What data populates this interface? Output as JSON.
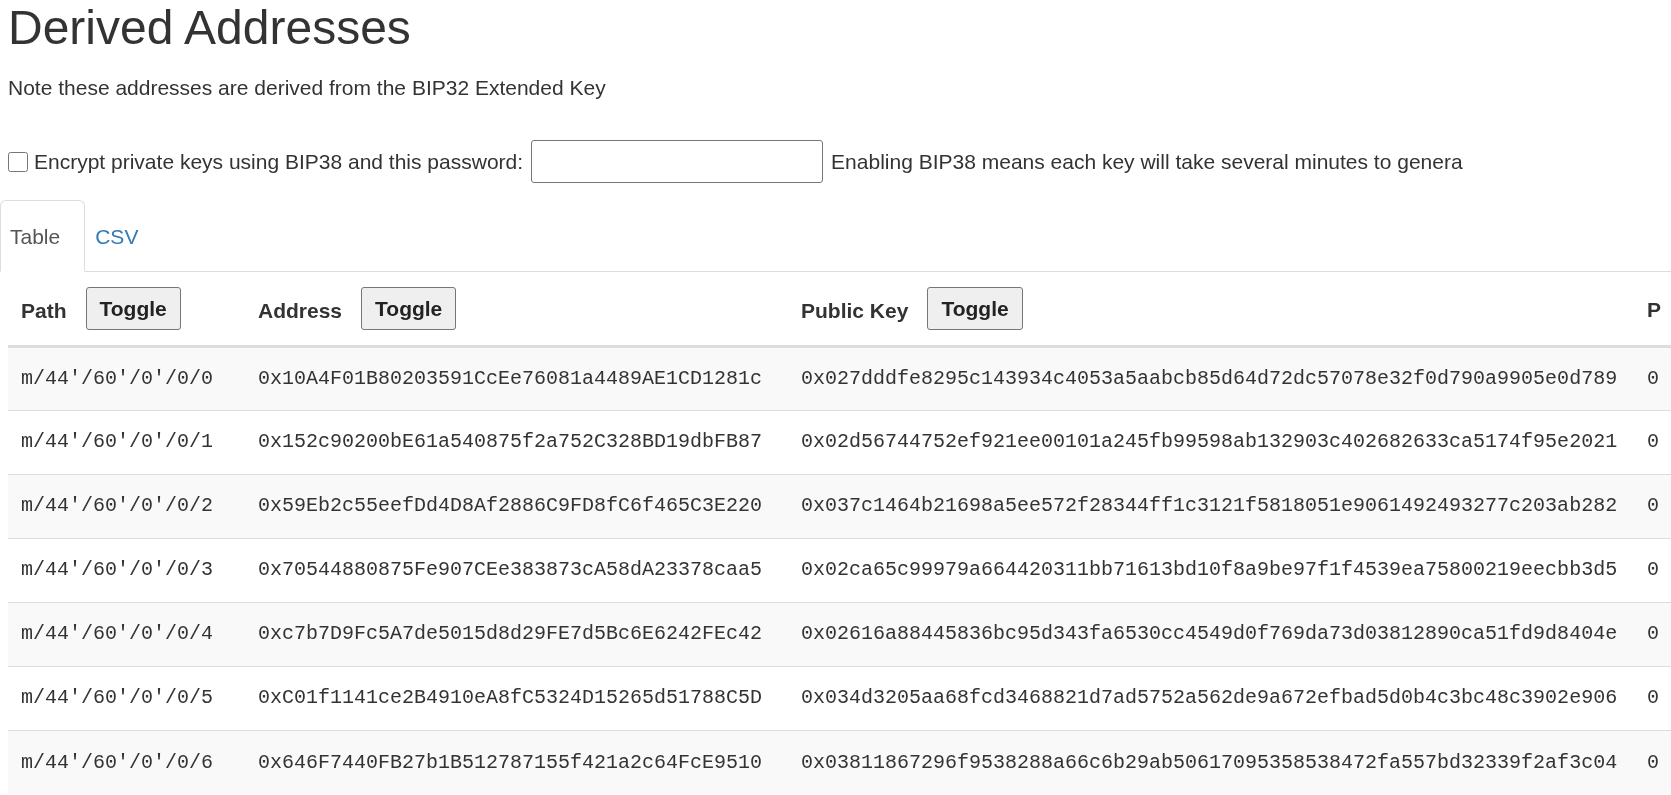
{
  "heading": "Derived Addresses",
  "note": "Note these addresses are derived from the BIP32 Extended Key",
  "bip38": {
    "checked": false,
    "label": "Encrypt private keys using BIP38 and this password:",
    "hint": "Enabling BIP38 means each key will take several minutes to genera"
  },
  "tabs": [
    {
      "label": "Table",
      "selected": true
    },
    {
      "label": "CSV",
      "selected": false
    }
  ],
  "table": {
    "columns": [
      {
        "label": "Path",
        "toggle": "Toggle"
      },
      {
        "label": "Address",
        "toggle": "Toggle"
      },
      {
        "label": "Public Key",
        "toggle": "Toggle"
      },
      {
        "label": "P"
      }
    ],
    "rows": [
      {
        "path": "m/44'/60'/0'/0/0",
        "address": "0x10A4F01B80203591CcEe76081a4489AE1CD1281c",
        "public_key": "0x027dddfe8295c143934c4053a5aabcb85d64d72dc57078e32f0d790a9905e0d789",
        "column_4": "0"
      },
      {
        "path": "m/44'/60'/0'/0/1",
        "address": "0x152c90200bE61a540875f2a752C328BD19dbFB87",
        "public_key": "0x02d56744752ef921ee00101a245fb99598ab132903c402682633ca5174f95e2021",
        "column_4": "0"
      },
      {
        "path": "m/44'/60'/0'/0/2",
        "address": "0x59Eb2c55eefDd4D8Af2886C9FD8fC6f465C3E220",
        "public_key": "0x037c1464b21698a5ee572f28344ff1c3121f5818051e9061492493277c203ab282",
        "column_4": "0"
      },
      {
        "path": "m/44'/60'/0'/0/3",
        "address": "0x70544880875Fe907CEe383873cA58dA23378caa5",
        "public_key": "0x02ca65c99979a664420311bb71613bd10f8a9be97f1f4539ea75800219eecbb3d5",
        "column_4": "0"
      },
      {
        "path": "m/44'/60'/0'/0/4",
        "address": "0xc7b7D9Fc5A7de5015d8d29FE7d5Bc6E6242FEc42",
        "public_key": "0x02616a88445836bc95d343fa6530cc4549d0f769da73d03812890ca51fd9d8404e",
        "column_4": "0"
      },
      {
        "path": "m/44'/60'/0'/0/5",
        "address": "0xC01f1141ce2B4910eA8fC5324D15265d51788C5D",
        "public_key": "0x034d3205aa68fcd3468821d7ad5752a562de9a672efbad5d0b4c3bc48c3902e906",
        "column_4": "0"
      },
      {
        "path": "m/44'/60'/0'/0/6",
        "address": "0x646F7440FB27b1B512787155f421a2c64FcE9510",
        "public_key": "0x03811867296f9538288a66c6b29ab50617095358538472fa557bd32339f2af3c04",
        "column_4": "0"
      }
    ]
  }
}
